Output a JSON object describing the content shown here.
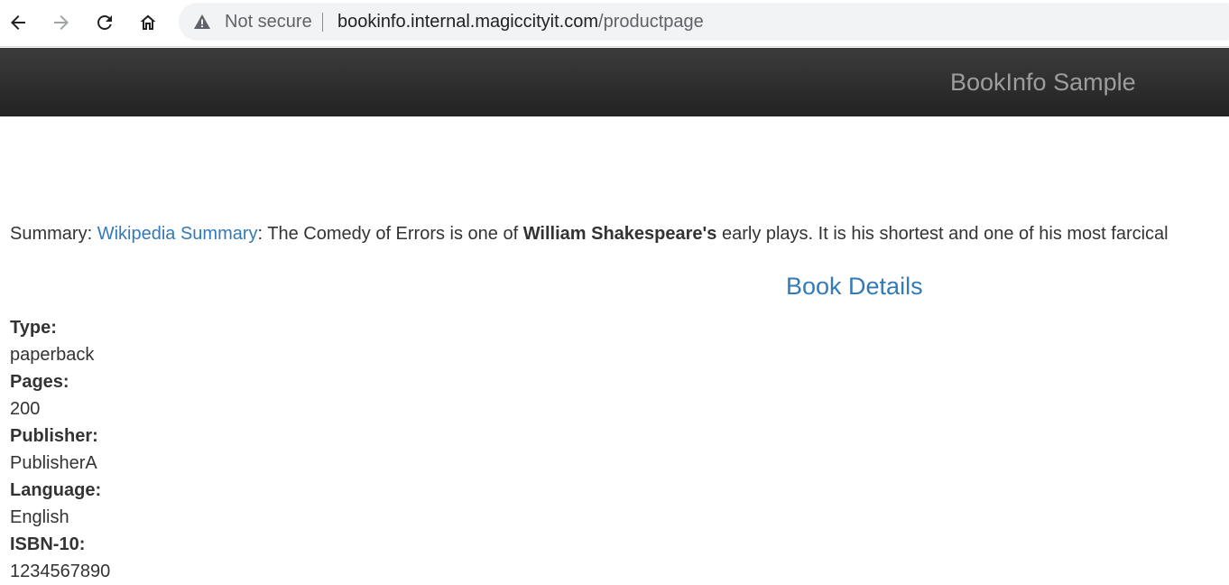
{
  "browser": {
    "security_label": "Not secure",
    "url_host": "bookinfo.internal.magiccityit.com",
    "url_path": "/productpage",
    "icons": [
      "back-arrow-icon",
      "forward-arrow-icon",
      "reload-icon",
      "home-icon",
      "warning-triangle-icon"
    ]
  },
  "navbar": {
    "brand": "BookInfo Sample"
  },
  "summary": {
    "prefix": "Summary: ",
    "link_text": "Wikipedia Summary",
    "text_before_bold": ": The Comedy of Errors is one of ",
    "bold_text": "William Shakespeare's",
    "text_after_bold": " early plays. It is his shortest and one of his most farcical"
  },
  "book_details": {
    "title": "Book Details",
    "items": [
      {
        "label": "Type:",
        "value": "paperback"
      },
      {
        "label": "Pages:",
        "value": "200"
      },
      {
        "label": "Publisher:",
        "value": "PublisherA"
      },
      {
        "label": "Language:",
        "value": "English"
      },
      {
        "label": "ISBN-10:",
        "value": "1234567890"
      }
    ]
  },
  "colors": {
    "link": "#337ab7",
    "navbar_top": "#3c3c3c",
    "navbar_bottom": "#222222",
    "brand": "#9d9d9d",
    "text": "#333333"
  }
}
